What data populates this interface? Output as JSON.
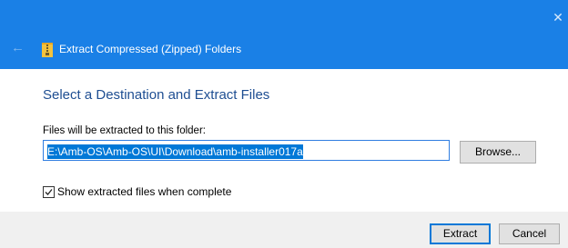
{
  "window": {
    "title": "Extract Compressed (Zipped) Folders",
    "close_glyph": "✕",
    "back_glyph": "←",
    "titlebar_color": "#1a80e6"
  },
  "content": {
    "heading": "Select a Destination and Extract Files",
    "path_label": "Files will be extracted to this folder:",
    "path_value": "E:\\Amb-OS\\Amb-OS\\UI\\Download\\amb-installer017a",
    "browse_label": "Browse...",
    "show_files_label": "Show extracted files when complete",
    "show_files_checked": true
  },
  "footer": {
    "extract_label": "Extract",
    "cancel_label": "Cancel"
  },
  "icons": {
    "back": "back-arrow-icon",
    "folder": "zipped-folder-icon",
    "close": "close-icon",
    "check": "checkmark-icon"
  },
  "colors": {
    "heading": "#1e4e92",
    "selection": "#0078d7",
    "focus_border": "#0078d7"
  }
}
